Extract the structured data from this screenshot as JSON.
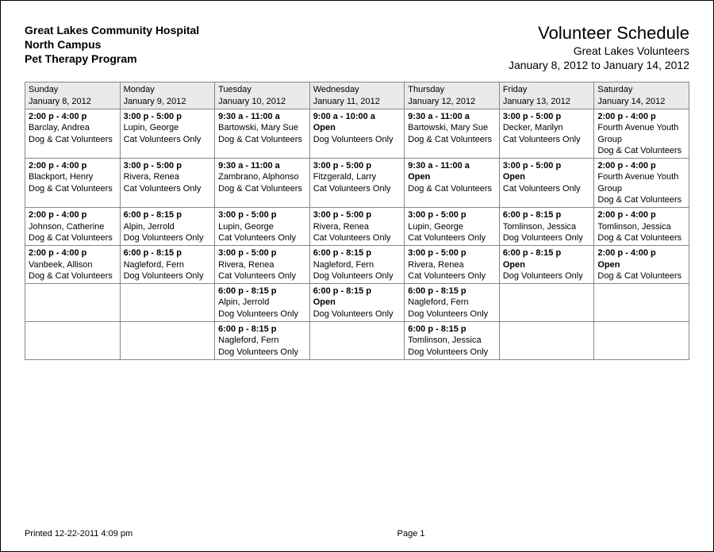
{
  "header": {
    "org": "Great Lakes Community Hospital",
    "campus": "North Campus",
    "program": "Pet Therapy Program",
    "title": "Volunteer Schedule",
    "subtitle": "Great Lakes Volunteers",
    "daterange": "January 8, 2012 to January 14, 2012"
  },
  "days": [
    {
      "name": "Sunday",
      "date": "January 8, 2012"
    },
    {
      "name": "Monday",
      "date": "January 9, 2012"
    },
    {
      "name": "Tuesday",
      "date": "January 10, 2012"
    },
    {
      "name": "Wednesday",
      "date": "January 11, 2012"
    },
    {
      "name": "Thursday",
      "date": "January 12, 2012"
    },
    {
      "name": "Friday",
      "date": "January 13, 2012"
    },
    {
      "name": "Saturday",
      "date": "January 14, 2012"
    }
  ],
  "grid": [
    [
      {
        "time": "2:00 p - 4:00 p",
        "who": "Barclay, Andrea",
        "note": "Dog & Cat Volunteers"
      },
      {
        "time": "3:00 p - 5:00 p",
        "who": "Lupin, George",
        "note": "Cat Volunteers Only"
      },
      {
        "time": "9:30 a - 11:00 a",
        "who": "Bartowski, Mary Sue",
        "note": "Dog & Cat Volunteers"
      },
      {
        "time": "9:00 a - 10:00 a",
        "who": "Open",
        "note": "Dog Volunteers Only",
        "open": true
      },
      {
        "time": "9:30 a - 11:00 a",
        "who": "Bartowski, Mary Sue",
        "note": "Dog & Cat Volunteers"
      },
      {
        "time": "3:00 p - 5:00 p",
        "who": "Decker, Marilyn",
        "note": "Cat Volunteers Only"
      },
      {
        "time": "2:00 p - 4:00 p",
        "who": "Fourth Avenue Youth Group",
        "note": "Dog & Cat Volunteers"
      }
    ],
    [
      {
        "time": "2:00 p - 4:00 p",
        "who": "Blackport, Henry",
        "note": "Dog & Cat Volunteers"
      },
      {
        "time": "3:00 p - 5:00 p",
        "who": "Rivera, Renea",
        "note": "Cat Volunteers Only"
      },
      {
        "time": "9:30 a - 11:00 a",
        "who": "Zambrano, Alphonso",
        "note": "Dog & Cat Volunteers"
      },
      {
        "time": "3:00 p - 5:00 p",
        "who": "Fitzgerald, Larry",
        "note": "Cat Volunteers Only"
      },
      {
        "time": "9:30 a - 11:00 a",
        "who": "Open",
        "note": "Dog & Cat Volunteers",
        "open": true
      },
      {
        "time": "3:00 p - 5:00 p",
        "who": "Open",
        "note": "Cat Volunteers Only",
        "open": true
      },
      {
        "time": "2:00 p - 4:00 p",
        "who": "Fourth Avenue Youth Group",
        "note": "Dog & Cat Volunteers"
      }
    ],
    [
      {
        "time": "2:00 p - 4:00 p",
        "who": "Johnson, Catherine",
        "note": "Dog & Cat Volunteers"
      },
      {
        "time": "6:00 p - 8:15 p",
        "who": "Alpin, Jerrold",
        "note": "Dog Volunteers Only"
      },
      {
        "time": "3:00 p - 5:00 p",
        "who": "Lupin, George",
        "note": "Cat Volunteers Only"
      },
      {
        "time": "3:00 p - 5:00 p",
        "who": "Rivera, Renea",
        "note": "Cat Volunteers Only"
      },
      {
        "time": "3:00 p - 5:00 p",
        "who": "Lupin, George",
        "note": "Cat Volunteers Only"
      },
      {
        "time": "6:00 p - 8:15 p",
        "who": "Tomlinson, Jessica",
        "note": "Dog Volunteers Only"
      },
      {
        "time": "2:00 p - 4:00 p",
        "who": "Tomlinson, Jessica",
        "note": "Dog & Cat Volunteers"
      }
    ],
    [
      {
        "time": "2:00 p - 4:00 p",
        "who": "Vanbeek, Allison",
        "note": "Dog & Cat Volunteers"
      },
      {
        "time": "6:00 p - 8:15 p",
        "who": "Nagleford, Fern",
        "note": "Dog Volunteers Only"
      },
      {
        "time": "3:00 p - 5:00 p",
        "who": "Rivera, Renea",
        "note": "Cat Volunteers Only"
      },
      {
        "time": "6:00 p - 8:15 p",
        "who": "Nagleford, Fern",
        "note": "Dog Volunteers Only"
      },
      {
        "time": "3:00 p - 5:00 p",
        "who": "Rivera, Renea",
        "note": "Cat Volunteers Only"
      },
      {
        "time": "6:00 p - 8:15 p",
        "who": "Open",
        "note": "Dog Volunteers Only",
        "open": true
      },
      {
        "time": "2:00 p - 4:00 p",
        "who": "Open",
        "note": "Dog & Cat Volunteers",
        "open": true
      }
    ],
    [
      null,
      null,
      {
        "time": "6:00 p - 8:15 p",
        "who": "Alpin, Jerrold",
        "note": "Dog Volunteers Only"
      },
      {
        "time": "6:00 p - 8:15 p",
        "who": "Open",
        "note": "Dog Volunteers Only",
        "open": true
      },
      {
        "time": "6:00 p - 8:15 p",
        "who": "Nagleford, Fern",
        "note": "Dog Volunteers Only"
      },
      null,
      null
    ],
    [
      null,
      null,
      {
        "time": "6:00 p - 8:15 p",
        "who": "Nagleford, Fern",
        "note": "Dog Volunteers Only"
      },
      null,
      {
        "time": "6:00 p - 8:15 p",
        "who": "Tomlinson, Jessica",
        "note": "Dog Volunteers Only"
      },
      null,
      null
    ]
  ],
  "footer": {
    "printed": "Printed 12-22-2011 4:09 pm",
    "page": "Page 1"
  }
}
